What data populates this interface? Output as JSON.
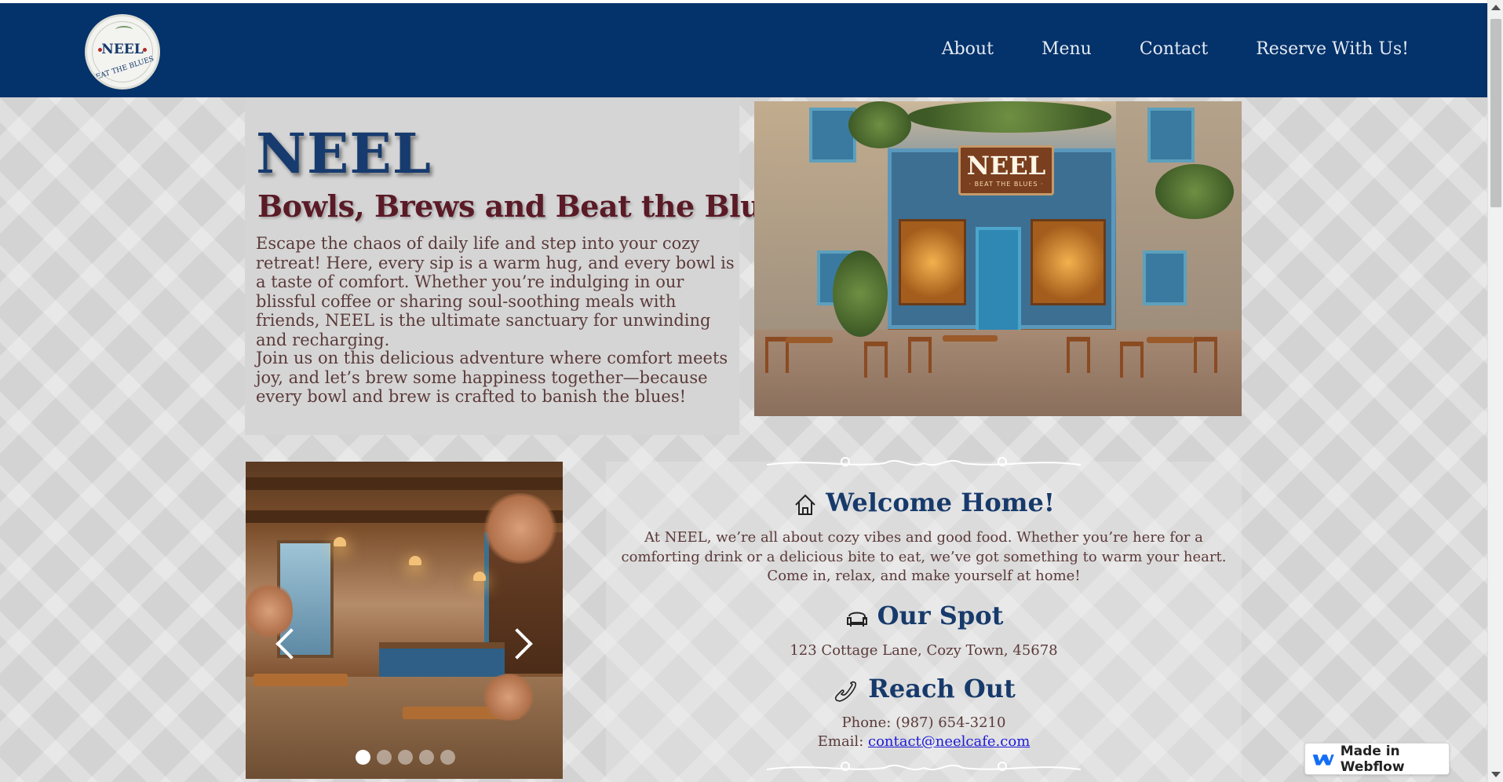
{
  "brand": {
    "logo_title": "NEEL",
    "logo_subtitle": "BEAT THE BLUES"
  },
  "nav": {
    "items": [
      {
        "label": "About"
      },
      {
        "label": "Menu"
      },
      {
        "label": "Contact"
      },
      {
        "label": "Reserve With Us!"
      }
    ]
  },
  "hero": {
    "title": "NEEL",
    "subtitle": "Bowls, Brews and Beat the Blues",
    "paragraph1": "Escape the chaos of daily life and step into your cozy retreat! Here, every sip is a warm hug, and every bowl is a taste of comfort. Whether you’re indulging in our blissful coffee or sharing soul-soothing meals with friends, NEEL is the ultimate sanctuary for unwinding and recharging.",
    "paragraph2": "Join us on this delicious adventure where comfort meets joy, and let’s brew some happiness together—because every bowl and brew is crafted to banish the blues!",
    "image_sign_title": "NEEL",
    "image_sign_subtitle": "· BEAT THE BLUES ·"
  },
  "slider": {
    "slide_count": 5,
    "active_slide": 1
  },
  "info": {
    "welcome_heading": "Welcome Home!",
    "welcome_text": "At NEEL, we’re all about cozy vibes and good food. Whether you’re here for a comforting drink or a delicious bite to eat, we’ve got something to warm your heart. Come in, relax, and make yourself at home!",
    "spot_heading": "Our Spot",
    "spot_address": "123 Cottage Lane, Cozy Town, 45678",
    "reach_heading": "Reach Out",
    "phone_line": "Phone: (987) 654-3210",
    "email_label": "Email: ",
    "email_value": "contact@neelcafe.com"
  },
  "badge": {
    "label": "Made in Webflow"
  },
  "colors": {
    "nav_bg": "#04326a",
    "title_blue": "#173b6e",
    "subtitle_maroon": "#5a1a26",
    "body_text": "#5c3a3a",
    "link": "#1d1bd8"
  },
  "icons": [
    "home-icon",
    "sofa-icon",
    "phone-icon",
    "chevron-left-icon",
    "chevron-right-icon",
    "webflow-logo-icon"
  ]
}
